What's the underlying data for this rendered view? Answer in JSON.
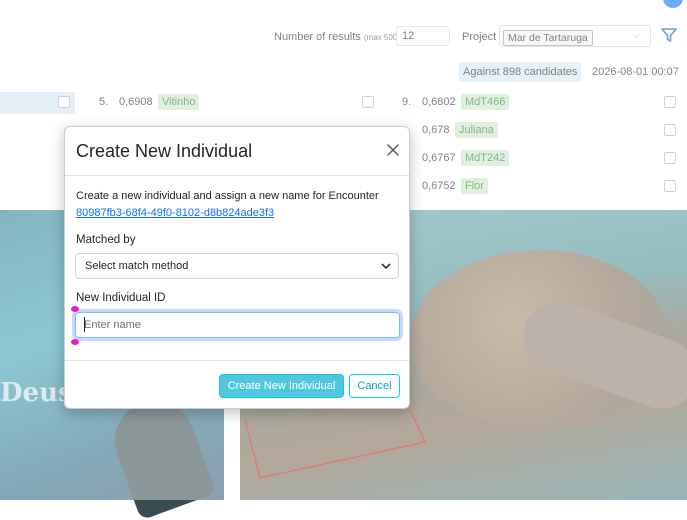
{
  "header": {
    "results_label": "Number of results",
    "results_max": "(max 500)",
    "results_value": "12",
    "project_label": "Project",
    "project_value": "Mar de Tartaruga",
    "against_label": "Against 898 candidates",
    "date": "2026-08-01 00:07"
  },
  "matches": [
    {
      "rank": "5.",
      "score": "0,6908",
      "name": "Vitinho"
    },
    {
      "rank": "9.",
      "score": "0,6802",
      "name": "MdT466"
    },
    {
      "rank": "",
      "score": "0,678",
      "name": "Juliana"
    },
    {
      "rank": "",
      "score": "0,6767",
      "name": "MdT242"
    },
    {
      "rank": "",
      "score": "0,6752",
      "name": "Flor"
    }
  ],
  "image_left": {
    "watermark": "Deus"
  },
  "modal": {
    "title": "Create New Individual",
    "description": "Create a new individual and assign a new name for Encounter",
    "encounter_id": "80987fb3-68f4-49f0-8102-d8b824ade3f3",
    "matched_by_label": "Matched by",
    "matched_by_value": "Select match method",
    "new_id_label": "New Individual ID",
    "new_id_placeholder": "Enter name",
    "create_button": "Create New Individual",
    "cancel_button": "Cancel"
  },
  "colors": {
    "accent": "#0dcaf0",
    "link": "#0d6efd",
    "badge_bg": "#c8e6c9",
    "badge_text": "#2e7d32",
    "selection_handle": "#e61ebe"
  },
  "icons": {
    "close": "close-icon",
    "filter": "filter-icon",
    "dropdown": "chevron-down-icon",
    "info": "info-icon"
  }
}
